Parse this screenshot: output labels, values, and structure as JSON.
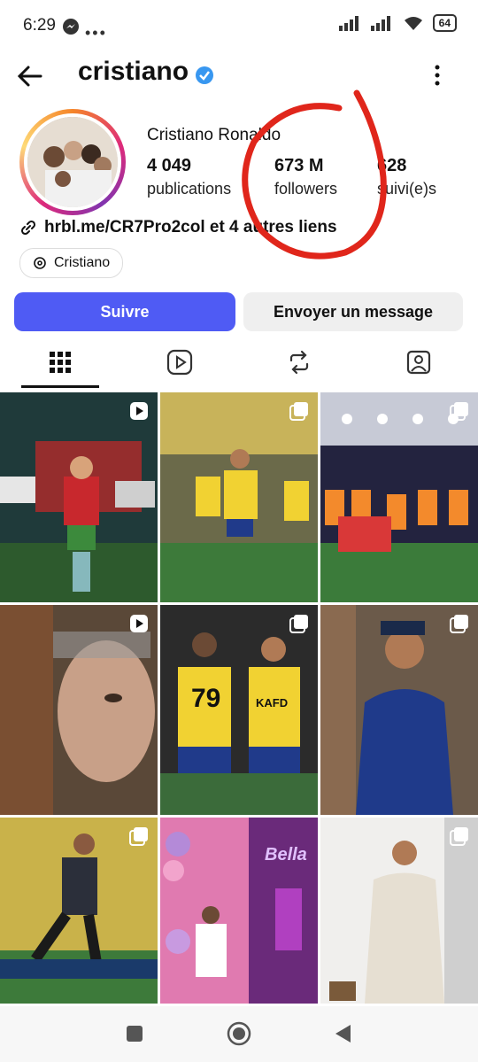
{
  "status_bar": {
    "time": "6:29",
    "battery": "64"
  },
  "header": {
    "username": "cristiano"
  },
  "profile": {
    "full_name": "Cristiano Ronaldo",
    "stats": [
      {
        "value": "4 049",
        "label": "publications"
      },
      {
        "value": "673 M",
        "label": "followers"
      },
      {
        "value": "628",
        "label": "suivi(e)s"
      }
    ],
    "link_text": "hrbl.me/CR7Pro2col et 4 autres liens",
    "threads_label": "Cristiano"
  },
  "actions": {
    "follow_label": "Suivre",
    "message_label": "Envoyer un message"
  },
  "tabs": [
    "grid",
    "reels",
    "reposts",
    "tagged"
  ],
  "grid_posts": [
    {
      "type": "reel"
    },
    {
      "type": "carousel"
    },
    {
      "type": "carousel"
    },
    {
      "type": "reel"
    },
    {
      "type": "carousel"
    },
    {
      "type": "carousel"
    },
    {
      "type": "carousel"
    },
    {
      "type": "post"
    },
    {
      "type": "carousel"
    }
  ],
  "jersey_text": "KAFD",
  "jersey_number": "79",
  "banner_text": "Bella",
  "colors": {
    "accent": "#4f5bf4",
    "verified": "#3897f0",
    "annotation": "#e0261b"
  }
}
